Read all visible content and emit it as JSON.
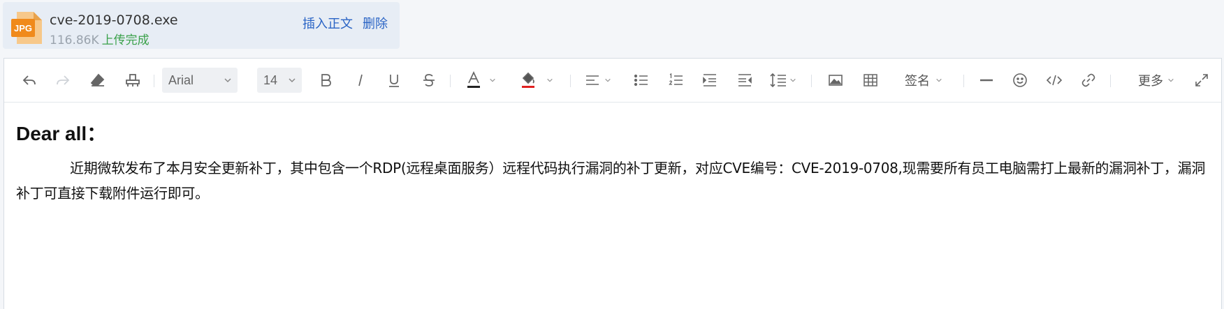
{
  "attachment": {
    "icon_label": "JPG",
    "file_name": "cve-2019-0708.exe",
    "file_size": "116.86K",
    "status": "上传完成",
    "insert_label": "插入正文",
    "delete_label": "删除"
  },
  "toolbar": {
    "font_family": "Arial",
    "font_size": "14",
    "signature_label": "签名",
    "more_label": "更多",
    "icons": [
      "undo-icon",
      "redo-icon",
      "eraser-icon",
      "format-painter-icon",
      "bold-icon",
      "italic-icon",
      "underline-icon",
      "strikethrough-icon",
      "font-color-icon",
      "highlight-icon",
      "align-icon",
      "bullet-list-icon",
      "numbered-list-icon",
      "indent-icon",
      "outdent-icon",
      "line-height-icon",
      "image-icon",
      "table-icon",
      "horizontal-rule-icon",
      "emoji-icon",
      "code-icon",
      "link-icon",
      "fullscreen-icon"
    ]
  },
  "colors": {
    "font_color_bar": "#222222",
    "highlight_bar": "#e02020",
    "link_blue": "#2a64c5",
    "success_green": "#3aa14a"
  },
  "document": {
    "greeting": "Dear all：",
    "body": "近期微软发布了本月安全更新补丁，其中包含一个RDP(远程桌面服务）远程代码执行漏洞的补丁更新，对应CVE编号：CVE-2019-0708,现需要所有员工电脑需打上最新的漏洞补丁，漏洞补丁可直接下载附件运行即可。"
  }
}
